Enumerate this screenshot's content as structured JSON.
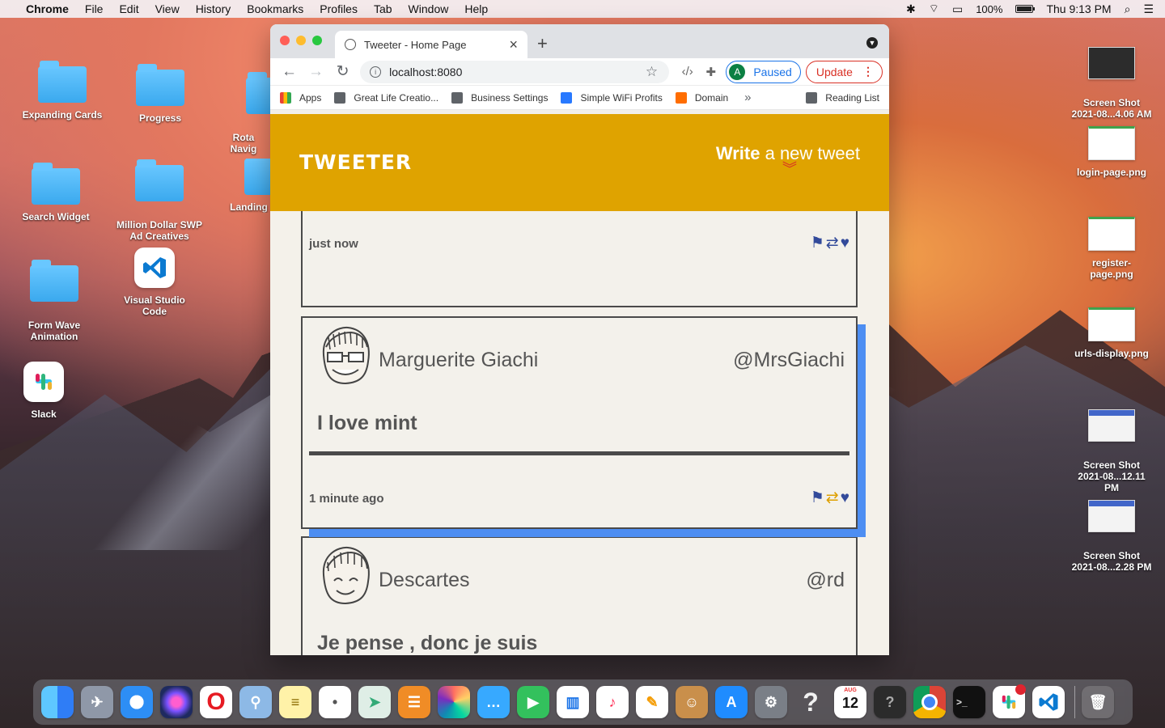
{
  "menubar": {
    "apple": "",
    "app": "Chrome",
    "items": [
      "File",
      "Edit",
      "View",
      "History",
      "Bookmarks",
      "Profiles",
      "Tab",
      "Window",
      "Help"
    ],
    "battery_percent": "100%",
    "battery_level": 1.0,
    "time": "Thu 9:13 PM"
  },
  "desktop": {
    "left_items": [
      {
        "label": "Expanding Cards",
        "type": "folder"
      },
      {
        "label": "Progress",
        "type": "folder"
      },
      {
        "label": "Rota\nNavig",
        "type": "folder"
      },
      {
        "label": "Search Widget",
        "type": "folder"
      },
      {
        "label": "Million Dollar SWP\nAd Creatives",
        "type": "folder"
      },
      {
        "label": "Landing",
        "type": "folder"
      },
      {
        "label": "Form Wave\nAnimation",
        "type": "folder"
      },
      {
        "label": "Visual Studio Code",
        "type": "vscode"
      },
      {
        "label": "Slack",
        "type": "slack"
      }
    ],
    "right_items": [
      {
        "label": "Screen Shot\n2021-08...4.06 AM"
      },
      {
        "label": "login-page.png"
      },
      {
        "label": "register-page.png"
      },
      {
        "label": "urls-display.png"
      },
      {
        "label": "Screen Shot\n2021-08...12.11 PM"
      },
      {
        "label": "Screen Shot\n2021-08...2.28 PM"
      }
    ]
  },
  "browser": {
    "tab_title": "Tweeter - Home Page",
    "tab_close": "×",
    "new_tab": "+",
    "url": "localhost:8080",
    "profile_letter": "A",
    "paused_label": "Paused",
    "update_label": "Update",
    "update_menu": "⋮",
    "bookmarks": [
      {
        "label": "Apps"
      },
      {
        "label": "Great Life Creatio..."
      },
      {
        "label": "Business Settings"
      },
      {
        "label": "Simple WiFi Profits"
      },
      {
        "label": "Domain"
      }
    ],
    "more_bookmarks": "»",
    "reading_list": "Reading List"
  },
  "site": {
    "brand": "TWEETER",
    "compose_bold": "Write",
    "compose_rest": " a new tweet",
    "compose_chevron": "︾",
    "tweets": [
      {
        "time": "just now"
      },
      {
        "name": "Marguerite Giachi",
        "handle": "@MrsGiachi",
        "content": "I love mint",
        "time": "1 minute ago"
      },
      {
        "name": "Descartes",
        "handle": "@rd",
        "content": "Je pense , donc je suis"
      }
    ]
  },
  "colors": {
    "header": "#dfa300",
    "action_blue": "#324a9a",
    "shadow_blue": "#4d8ef2",
    "update_red": "#d93025",
    "paused_blue": "#1a73e8"
  },
  "dock": {
    "items": [
      {
        "name": "Finder",
        "icon": "finder-icon"
      },
      {
        "name": "Launchpad",
        "icon": "launchpad-icon"
      },
      {
        "name": "Safari",
        "icon": "safari-icon"
      },
      {
        "name": "Siri",
        "icon": "siri-icon"
      },
      {
        "name": "Opera",
        "icon": "opera-icon"
      },
      {
        "name": "Preview",
        "icon": "preview-icon"
      },
      {
        "name": "Notes",
        "icon": "notes-icon"
      },
      {
        "name": "Reminders",
        "icon": "reminders-icon"
      },
      {
        "name": "Maps",
        "icon": "maps-icon"
      },
      {
        "name": "Books",
        "icon": "books-icon"
      },
      {
        "name": "Photos",
        "icon": "photos-icon"
      },
      {
        "name": "Messages",
        "icon": "messages-icon"
      },
      {
        "name": "FaceTime",
        "icon": "facetime-icon"
      },
      {
        "name": "Numbers",
        "icon": "numbers-icon"
      },
      {
        "name": "Music",
        "icon": "music-icon"
      },
      {
        "name": "Pages",
        "icon": "pages-icon"
      },
      {
        "name": "Contacts",
        "icon": "contacts-icon"
      },
      {
        "name": "App Store",
        "icon": "app-store-icon"
      },
      {
        "name": "System Preferences",
        "icon": "settings-icon"
      },
      {
        "name": "Help",
        "icon": "help-icon"
      },
      {
        "name": "Calendar",
        "icon": "calendar-icon",
        "text": "12",
        "month": "AUG"
      },
      {
        "name": "Unknown",
        "icon": "question-icon",
        "text": "?"
      },
      {
        "name": "Chrome",
        "icon": "chrome-icon"
      },
      {
        "name": "Terminal",
        "icon": "terminal-icon",
        "text": ">_"
      },
      {
        "name": "Slack",
        "icon": "slack-icon"
      },
      {
        "name": "VS Code",
        "icon": "vscode-icon"
      },
      {
        "name": "Trash",
        "icon": "trash-icon"
      }
    ]
  }
}
